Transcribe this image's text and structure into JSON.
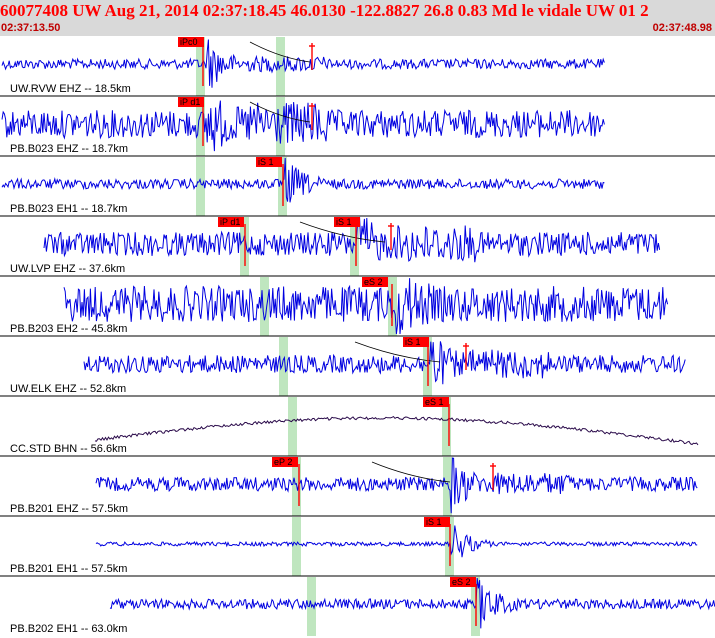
{
  "header": {
    "title": "60077408 UW Aug 21, 2014 02:37:18.45    46.0130 -122.8827 26.8 0.83 Md le vidale UW 01    2",
    "time_start": "02:37:13.50",
    "time_end": "02:37:48.98"
  },
  "colors": {
    "header_bg": "#d9d9d9",
    "title": "#ff0000",
    "trace_blue": "#0000e0",
    "trace_dark": "#2a0a4a",
    "pick": "#ff0000",
    "window_band": "#bfe6bf",
    "separator": "#000000"
  },
  "traces": [
    {
      "label": "UW.RVW EHZ -- 18.5km",
      "picks": [
        {
          "label": "iPc0"
        }
      ],
      "extra_marks": [
        {
          "type": "plus"
        }
      ],
      "style": "blue"
    },
    {
      "label": "PB.B023 EHZ -- 18.7km",
      "picks": [
        {
          "label": "iP d1"
        }
      ],
      "extra_marks": [
        {
          "type": "plus"
        }
      ],
      "style": "blue"
    },
    {
      "label": "PB.B023 EH1 -- 18.7km",
      "picks": [
        {
          "label": "iS 1"
        }
      ],
      "extra_marks": [],
      "style": "blue"
    },
    {
      "label": "UW.LVP EHZ -- 37.6km",
      "picks": [
        {
          "label": "iP d1"
        },
        {
          "label": "iS 1"
        }
      ],
      "extra_marks": [
        {
          "type": "plus"
        }
      ],
      "style": "blue"
    },
    {
      "label": "PB.B203 EH2 -- 45.8km",
      "picks": [
        {
          "label": "eS 2"
        }
      ],
      "extra_marks": [],
      "style": "blue"
    },
    {
      "label": "UW.ELK EHZ -- 52.8km",
      "picks": [
        {
          "label": "iS 1"
        }
      ],
      "extra_marks": [
        {
          "type": "plus"
        }
      ],
      "style": "blue"
    },
    {
      "label": "CC.STD BHN -- 56.6km",
      "picks": [
        {
          "label": "eS 1"
        }
      ],
      "extra_marks": [],
      "style": "dark"
    },
    {
      "label": "PB.B201 EHZ -- 57.5km",
      "picks": [
        {
          "label": "eP 2"
        }
      ],
      "extra_marks": [
        {
          "type": "plus"
        }
      ],
      "style": "blue"
    },
    {
      "label": "PB.B201 EH1 -- 57.5km",
      "picks": [
        {
          "label": "iS 1"
        }
      ],
      "extra_marks": [],
      "style": "blue"
    },
    {
      "label": "PB.B202 EH1 -- 63.0km",
      "picks": [
        {
          "label": "eS 2"
        }
      ],
      "extra_marks": [],
      "style": "blue"
    }
  ]
}
